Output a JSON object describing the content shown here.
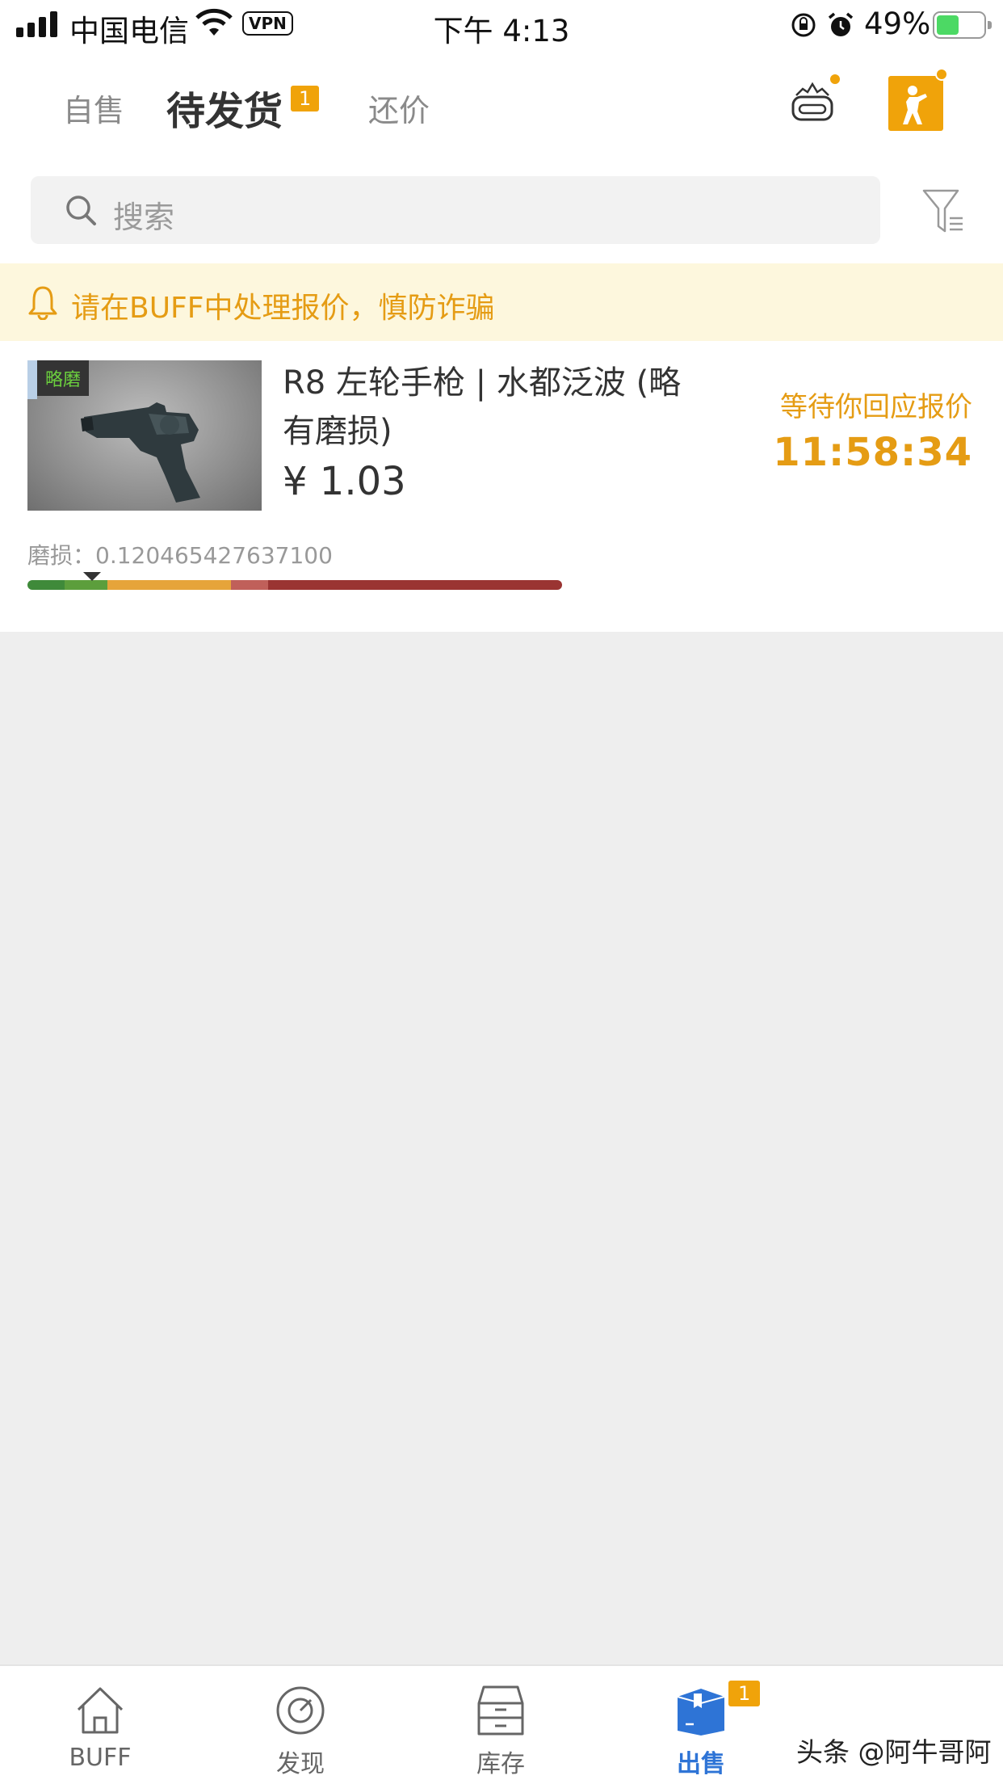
{
  "status_bar": {
    "carrier": "中国电信",
    "vpn": "VPN",
    "time": "下午 4:13",
    "battery": "49%",
    "battery_level": 0.49
  },
  "header": {
    "tabs": [
      {
        "label": "自售",
        "active": false
      },
      {
        "label": "待发货",
        "active": true
      },
      {
        "label": "还价",
        "active": false
      }
    ],
    "pending_badge": "1",
    "accent_color": "#f0a30a"
  },
  "search": {
    "placeholder": "搜索"
  },
  "notice": {
    "text": "请在BUFF中处理报价，慎防诈骗"
  },
  "item": {
    "wear_tag": "略磨",
    "name": "R8 左轮手枪 | 水都泛波 (略有磨损)",
    "price": "¥ 1.03",
    "status": "等待你回应报价",
    "countdown": "11:58:34",
    "wear_label": "磨损：0.120465427637100",
    "wear_value": 0.1204654276371
  },
  "bottom_nav": {
    "items": [
      {
        "label": "BUFF",
        "icon": "home-icon"
      },
      {
        "label": "发现",
        "icon": "discover-icon"
      },
      {
        "label": "库存",
        "icon": "inventory-icon"
      },
      {
        "label": "出售",
        "icon": "sell-box-icon",
        "active": true
      }
    ],
    "sell_badge": "1",
    "active_color": "#2e74d6"
  },
  "watermark": "头条 @阿牛哥阿"
}
